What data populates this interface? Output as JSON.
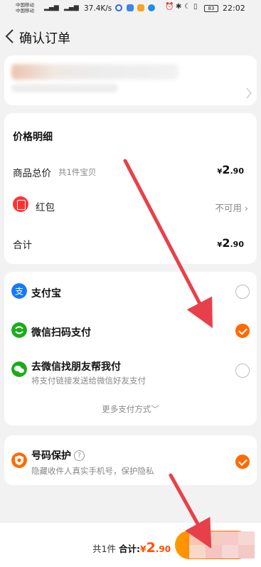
{
  "status_bar": {
    "carrier_1": "中国移动",
    "carrier_2": "中国移动",
    "net_speed": "37.4K/s",
    "battery": "83",
    "time": "22:02"
  },
  "header": {
    "title": "确认订单"
  },
  "price_detail": {
    "title": "价格明细",
    "goods_total_label": "商品总价",
    "goods_count": "共1件宝贝",
    "goods_total": {
      "currency": "¥",
      "int": "2",
      "dec": ".90"
    },
    "red_packet_label": "红包",
    "red_packet_status": "不可用",
    "total_label": "合计",
    "total": {
      "currency": "¥",
      "int": "2",
      "dec": ".90"
    }
  },
  "payment": {
    "methods": [
      {
        "label": "支付宝",
        "icon": "alipay-icon",
        "selected": false
      },
      {
        "label": "微信扫码支付",
        "icon": "wechat-scan-icon",
        "selected": true
      },
      {
        "label": "去微信找朋友帮我付",
        "sub": "将支付链接发送给微信好友支付",
        "icon": "wechat-friend-icon",
        "selected": false
      }
    ],
    "more": "更多支付方式"
  },
  "number_protect": {
    "label": "号码保护",
    "help": "?",
    "desc": "隐藏收件人真实手机号，保护隐私",
    "checked": true
  },
  "bottom": {
    "count": "共1件",
    "total_label": "合计:",
    "total": {
      "currency": "¥",
      "int": "2",
      "dec": ".90"
    },
    "submit_label": "提"
  },
  "colors": {
    "accent": "#ff6a00",
    "price_accent": "#ff5000",
    "annotation_arrow": "#e8404a",
    "alipay": "#1677ff",
    "wechat": "#1aad19"
  }
}
